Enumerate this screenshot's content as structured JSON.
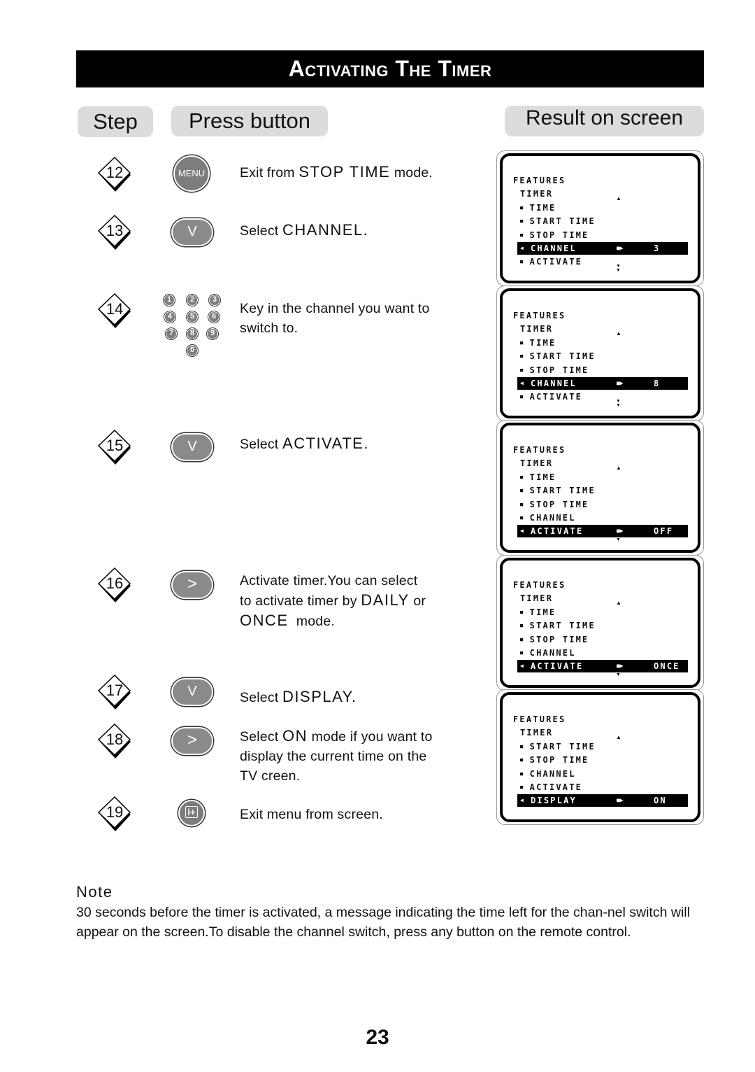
{
  "title": "Activating The Timer",
  "headers": {
    "step": "Step",
    "press_button": "Press button",
    "result": "Result on screen"
  },
  "steps": [
    {
      "num": "12",
      "button": "menu",
      "button_label": "MENU",
      "lines": [
        [
          {
            "t": "Exit from "
          },
          {
            "t": "STOP TIME",
            "k": true
          },
          {
            "t": " mode."
          }
        ]
      ]
    },
    {
      "num": "13",
      "button": "down",
      "button_label": "V",
      "lines": [
        [
          {
            "t": "Select "
          },
          {
            "t": "CHANNEL.",
            "k": true
          }
        ]
      ]
    },
    {
      "num": "14",
      "button": "numpad",
      "keys": [
        "1",
        "2",
        "3",
        "4",
        "5",
        "6",
        "7",
        "8",
        "9",
        "0"
      ],
      "lines": [
        [
          {
            "t": "Key in the channel you want to"
          }
        ],
        [
          {
            "t": "switch to."
          }
        ]
      ]
    },
    {
      "num": "15",
      "button": "down",
      "button_label": "V",
      "lines": [
        [
          {
            "t": "Select "
          },
          {
            "t": "ACTIVATE.",
            "k": true
          }
        ]
      ]
    },
    {
      "num": "16",
      "button": "right",
      "button_label": ">",
      "lines": [
        [
          {
            "t": "Activate timer.You can select"
          }
        ],
        [
          {
            "t": "to activate timer by "
          },
          {
            "t": "DAILY",
            "k": true
          },
          {
            "t": " or"
          }
        ],
        [
          {
            "t": "ONCE",
            "k": true
          },
          {
            "t": "  mode."
          }
        ]
      ]
    },
    {
      "num": "17",
      "button": "down",
      "button_label": "V",
      "lines": [
        [
          {
            "t": "Select "
          },
          {
            "t": "DISPLAY.",
            "k": true
          }
        ]
      ]
    },
    {
      "num": "18",
      "button": "right",
      "button_label": ">",
      "lines": [
        [
          {
            "t": "Select "
          },
          {
            "t": "ON",
            "k": true
          },
          {
            "t": " mode if you want to"
          }
        ],
        [
          {
            "t": "display the current time on the"
          }
        ],
        [
          {
            "t": "TV creen."
          }
        ]
      ]
    },
    {
      "num": "19",
      "button": "info",
      "button_label": "i+",
      "lines": [
        [
          {
            "t": "Exit menu from screen."
          }
        ]
      ]
    }
  ],
  "screens": [
    {
      "rows": [
        {
          "label": "FEATURES",
          "type": "title"
        },
        {
          "label": "TIMER",
          "type": "sub"
        },
        {
          "label": "TIME"
        },
        {
          "label": "START TIME"
        },
        {
          "label": "STOP TIME"
        },
        {
          "label": "CHANNEL",
          "selected": true,
          "value": "3"
        },
        {
          "label": "ACTIVATE"
        }
      ]
    },
    {
      "rows": [
        {
          "label": "FEATURES",
          "type": "title"
        },
        {
          "label": "TIMER",
          "type": "sub"
        },
        {
          "label": "TIME"
        },
        {
          "label": "START TIME"
        },
        {
          "label": "STOP TIME"
        },
        {
          "label": "CHANNEL",
          "selected": true,
          "value": "8"
        },
        {
          "label": "ACTIVATE"
        }
      ]
    },
    {
      "rows": [
        {
          "label": "FEATURES",
          "type": "title"
        },
        {
          "label": "TIMER",
          "type": "sub"
        },
        {
          "label": "TIME"
        },
        {
          "label": "START TIME"
        },
        {
          "label": "STOP TIME"
        },
        {
          "label": "CHANNEL"
        },
        {
          "label": "ACTIVATE",
          "selected": true,
          "value": "OFF"
        }
      ]
    },
    {
      "rows": [
        {
          "label": "FEATURES",
          "type": "title"
        },
        {
          "label": "TIMER",
          "type": "sub"
        },
        {
          "label": "TIME"
        },
        {
          "label": "START TIME"
        },
        {
          "label": "STOP TIME"
        },
        {
          "label": "CHANNEL"
        },
        {
          "label": "ACTIVATE",
          "selected": true,
          "value": "ONCE"
        }
      ]
    },
    {
      "rows": [
        {
          "label": "FEATURES",
          "type": "title"
        },
        {
          "label": "TIMER",
          "type": "sub"
        },
        {
          "label": "START TIME"
        },
        {
          "label": "STOP TIME"
        },
        {
          "label": "CHANNEL"
        },
        {
          "label": "ACTIVATE"
        },
        {
          "label": "DISPLAY",
          "selected": true,
          "value": "ON"
        }
      ],
      "no_down_arrow": true
    }
  ],
  "note": {
    "title": "Note",
    "body": "30 seconds before the timer is activated, a message indicating the time left for the chan-nel switch will appear on the screen.To disable the channel switch, press any button on the remote control."
  },
  "page_number": "23"
}
